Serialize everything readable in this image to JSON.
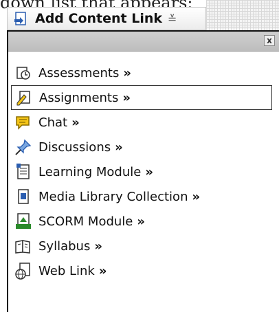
{
  "caption": "down list that appears:",
  "add_button": {
    "label": "Add Content Link",
    "chevron": "≚"
  },
  "menu": {
    "close_glyph": "x",
    "items": [
      {
        "label": "Assessments",
        "icon": "assessment-icon",
        "selected": false
      },
      {
        "label": "Assignments",
        "icon": "assignment-icon",
        "selected": true
      },
      {
        "label": "Chat",
        "icon": "chat-icon",
        "selected": false
      },
      {
        "label": "Discussions",
        "icon": "discussion-pin-icon",
        "selected": false
      },
      {
        "label": "Learning Module",
        "icon": "learning-module-icon",
        "selected": false
      },
      {
        "label": "Media Library Collection",
        "icon": "media-library-icon",
        "selected": false
      },
      {
        "label": "SCORM Module",
        "icon": "scorm-icon",
        "selected": false
      },
      {
        "label": "Syllabus",
        "icon": "syllabus-icon",
        "selected": false
      },
      {
        "label": "Web Link",
        "icon": "web-link-icon",
        "selected": false
      }
    ],
    "arrow": "»"
  },
  "colors": {
    "accent_blue": "#2a5db0",
    "chat_yellow": "#f5c518"
  }
}
